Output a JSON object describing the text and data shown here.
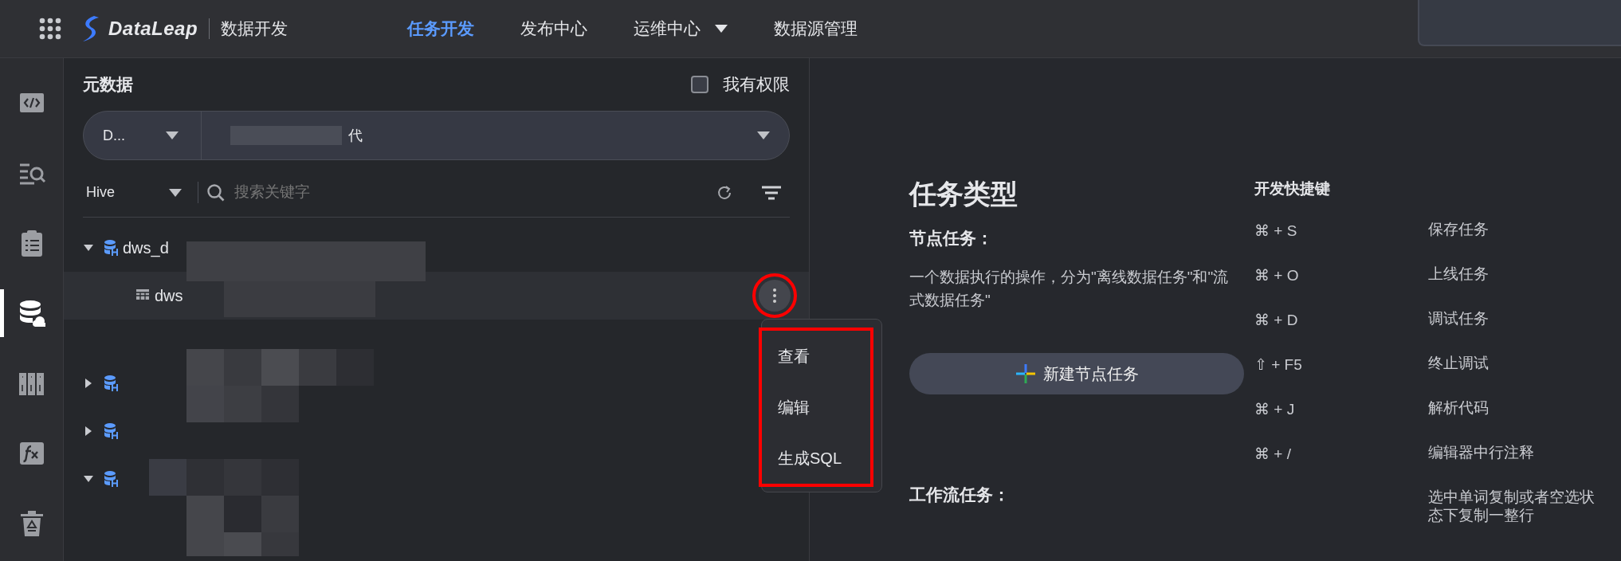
{
  "topbar": {
    "brand": "DataLeap",
    "module": "数据开发",
    "tabs": [
      {
        "label": "任务开发",
        "selected": true,
        "dropdown": false
      },
      {
        "label": "发布中心",
        "selected": false,
        "dropdown": false
      },
      {
        "label": "运维中心",
        "selected": false,
        "dropdown": true
      },
      {
        "label": "数据源管理",
        "selected": false,
        "dropdown": false
      }
    ]
  },
  "rail": [
    {
      "kind": "code",
      "selected": false
    },
    {
      "kind": "query",
      "selected": false
    },
    {
      "kind": "clipboard",
      "selected": false
    },
    {
      "kind": "database",
      "selected": true
    },
    {
      "kind": "servers",
      "selected": false
    },
    {
      "kind": "function",
      "selected": false
    },
    {
      "kind": "trash",
      "selected": false
    }
  ],
  "metadata": {
    "title": "元数据",
    "permission": {
      "label": "我有权限",
      "checked": false
    },
    "source_select": "D...",
    "schema_select": "代",
    "engine_select": "Hive",
    "search": {
      "placeholder": "搜索关键字"
    },
    "tree": [
      {
        "label": "dws_d",
        "kind": "database",
        "expanded": true,
        "children": [
          {
            "label": "dws",
            "kind": "table",
            "selected": true,
            "more_highlighted": true
          }
        ]
      },
      {
        "kind": "database",
        "expanded": false
      },
      {
        "kind": "database",
        "expanded": false
      },
      {
        "kind": "database",
        "expanded": true
      }
    ],
    "context_menu": {
      "highlighted": true,
      "items": [
        "查看",
        "编辑",
        "生成SQL"
      ]
    }
  },
  "task_types": {
    "title": "任务类型",
    "node_heading": "节点任务：",
    "node_description": "一个数据执行的操作，分为\"离线数据任务\"和\"流式数据任务\"",
    "new_button": "新建节点任务",
    "workflow_heading": "工作流任务："
  },
  "shortcuts": {
    "title": "开发快捷键",
    "items": [
      {
        "keys": "⌘ + S",
        "action": "保存任务"
      },
      {
        "keys": "⌘ + O",
        "action": "上线任务"
      },
      {
        "keys": "⌘ + D",
        "action": "调试任务"
      },
      {
        "keys": "⇧ + F5",
        "action": "终止调试"
      },
      {
        "keys": "⌘ + J",
        "action": "解析代码"
      },
      {
        "keys": "⌘ + /",
        "action": "编辑器中行注释"
      },
      {
        "action": "选中单词复制或者空选状态下复制一整行"
      }
    ]
  }
}
